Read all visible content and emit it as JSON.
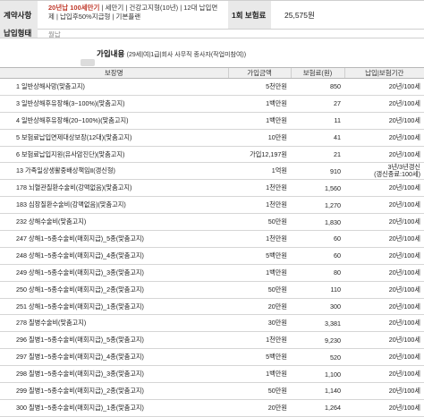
{
  "contract": {
    "contract_label": "계약사항",
    "period_highlight": "20년납 100세만기",
    "period_rest": " | 세만기 | 건강고지형(10년) | 12대 납입면제 | 납입후50%지급형 | 기본플랜",
    "premium_label": "1회 보험료",
    "premium_value": "25,575원",
    "status_label": "납입형태",
    "status_value": "월납"
  },
  "coverage": {
    "title_bold": "가입내용",
    "title_sub": "(29세|여|1급|회사 사무직 종사자(작업미참여))",
    "headers": {
      "name": "보장명",
      "amount": "가입금액",
      "premium": "보험료(원)",
      "period": "납입|보험기간"
    },
    "rows": [
      {
        "name": "1  일반상해사망(맞춤고지)",
        "amount": "5천만원",
        "premium": "850",
        "period": "20년/100세"
      },
      {
        "name": "3  일반상해후유장해(3~100%)(맞춤고지)",
        "amount": "1백만원",
        "premium": "27",
        "period": "20년/100세"
      },
      {
        "name": "4  일반상해후유장해(20~100%)(맞춤고지)",
        "amount": "1백만원",
        "premium": "11",
        "period": "20년/100세"
      },
      {
        "name": "5  보험료납입면제대상보장(12대)(맞춤고지)",
        "amount": "10만원",
        "premium": "41",
        "period": "20년/100세"
      },
      {
        "name": "6  보험료납입지원(유사암진단)(맞춤고지)",
        "amount": "가입12,197원",
        "premium": "21",
        "period": "20년/100세"
      },
      {
        "name": "13  가족일상생활중배상책임Ⅱ(갱신형)",
        "amount": "1억원",
        "premium": "910",
        "period": "3년/3년갱신\n(갱신종료:100세)"
      },
      {
        "name": "178  뇌혈관질환수술비(강맥없음)(맞춤고지)",
        "amount": "1천만원",
        "premium": "1,560",
        "period": "20년/100세"
      },
      {
        "name": "183  심장질환수술비(강맥없음)(맞춤고지)",
        "amount": "1천만원",
        "premium": "1,270",
        "period": "20년/100세"
      },
      {
        "name": "232  상해수술비(맞춤고지)",
        "amount": "50만원",
        "premium": "1,830",
        "period": "20년/100세"
      },
      {
        "name": "247  상해1~5종수술비(매회지급)_5종(맞춤고지)",
        "amount": "1천만원",
        "premium": "60",
        "period": "20년/100세"
      },
      {
        "name": "248  상해1~5종수술비(매회지급)_4종(맞춤고지)",
        "amount": "5백만원",
        "premium": "60",
        "period": "20년/100세"
      },
      {
        "name": "249  상해1~5종수술비(매회지급)_3종(맞춤고지)",
        "amount": "1백만원",
        "premium": "80",
        "period": "20년/100세"
      },
      {
        "name": "250  상해1~5종수술비(매회지급)_2종(맞춤고지)",
        "amount": "50만원",
        "premium": "110",
        "period": "20년/100세"
      },
      {
        "name": "251  상해1~5종수술비(매회지급)_1종(맞춤고지)",
        "amount": "20만원",
        "premium": "300",
        "period": "20년/100세"
      },
      {
        "name": "278  질병수술비(맞춤고지)",
        "amount": "30만원",
        "premium": "3,381",
        "period": "20년/100세"
      },
      {
        "name": "296  질병1~5종수술비(매회지급)_5종(맞춤고지)",
        "amount": "1천만원",
        "premium": "9,230",
        "period": "20년/100세"
      },
      {
        "name": "297  질병1~5종수술비(매회지급)_4종(맞춤고지)",
        "amount": "5백만원",
        "premium": "520",
        "period": "20년/100세"
      },
      {
        "name": "298  질병1~5종수술비(매회지급)_3종(맞춤고지)",
        "amount": "1백만원",
        "premium": "1,100",
        "period": "20년/100세"
      },
      {
        "name": "299  질병1~5종수술비(매회지급)_2종(맞춤고지)",
        "amount": "50만원",
        "premium": "1,140",
        "period": "20년/100세"
      },
      {
        "name": "300  질병1~5종수술비(매회지급)_1종(맞춤고지)",
        "amount": "20만원",
        "premium": "1,264",
        "period": "20년/100세"
      }
    ]
  }
}
